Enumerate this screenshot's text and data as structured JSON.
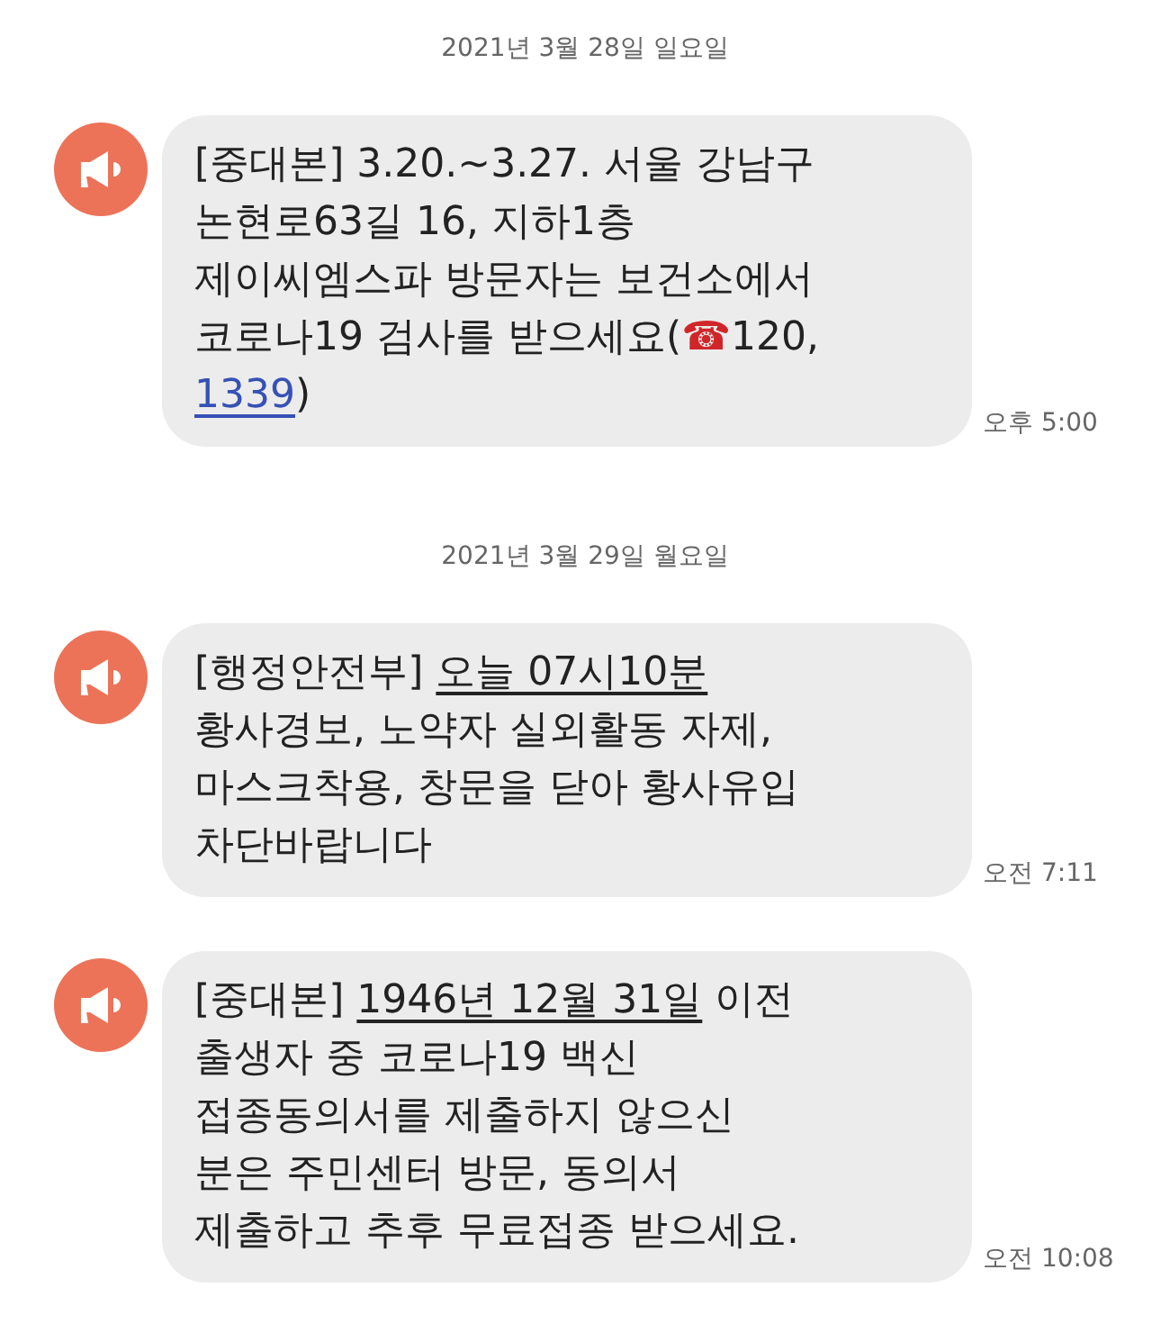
{
  "days": [
    {
      "date": "2021년 3월 28일 일요일",
      "messages": [
        {
          "time": "오후 5:00",
          "lines": [
            [
              {
                "kind": "text",
                "text": "[중대본] 3.20.~3.27. 서울 강남구"
              }
            ],
            [
              {
                "kind": "text",
                "text": "논현로63길 16, 지하1층"
              }
            ],
            [
              {
                "kind": "text",
                "text": "제이씨엠스파 방문자는 보건소에서"
              }
            ],
            [
              {
                "kind": "text",
                "text": "코로나19 검사를 받으세요("
              },
              {
                "kind": "emoji",
                "text": "☎"
              },
              {
                "kind": "text",
                "text": "120,"
              }
            ],
            [
              {
                "kind": "phone-link",
                "text": "1339"
              },
              {
                "kind": "text",
                "text": ")"
              }
            ]
          ]
        }
      ]
    },
    {
      "date": "2021년 3월 29일 월요일",
      "messages": [
        {
          "time": "오전 7:11",
          "lines": [
            [
              {
                "kind": "text",
                "text": "[행정안전부] "
              },
              {
                "kind": "date-link",
                "text": "오늘 07시10분"
              }
            ],
            [
              {
                "kind": "text",
                "text": "황사경보, 노약자 실외활동 자제,"
              }
            ],
            [
              {
                "kind": "text",
                "text": "마스크착용, 창문을 닫아 황사유입"
              }
            ],
            [
              {
                "kind": "text",
                "text": "차단바랍니다"
              }
            ]
          ]
        },
        {
          "time": "오전 10:08",
          "lines": [
            [
              {
                "kind": "text",
                "text": "[중대본] "
              },
              {
                "kind": "date-link",
                "text": "1946년 12월 31일"
              },
              {
                "kind": "text",
                "text": " 이전"
              }
            ],
            [
              {
                "kind": "text",
                "text": "출생자 중 코로나19 백신"
              }
            ],
            [
              {
                "kind": "text",
                "text": "접종동의서를 제출하지 않으신"
              }
            ],
            [
              {
                "kind": "text",
                "text": "분은 주민센터 방문, 동의서"
              }
            ],
            [
              {
                "kind": "text",
                "text": "제출하고 추후 무료접종 받으세요."
              }
            ]
          ]
        }
      ]
    }
  ]
}
